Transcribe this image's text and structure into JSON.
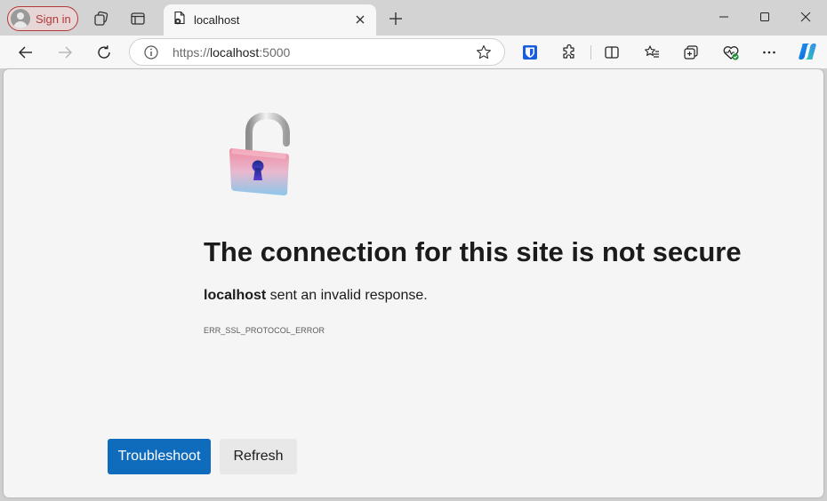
{
  "browser": {
    "signin_label": "Sign in",
    "tab": {
      "title": "localhost"
    },
    "address": {
      "scheme": "https://",
      "host": "localhost",
      "port": ":5000"
    }
  },
  "error_page": {
    "title": "The connection for this site is not secure",
    "description_host": "localhost",
    "description_rest": " sent an invalid response.",
    "error_code": "ERR_SSL_PROTOCOL_ERROR",
    "troubleshoot_label": "Troubleshoot",
    "refresh_label": "Refresh"
  },
  "colors": {
    "accent": "#0f6cbd",
    "signin_border": "#b33a3a",
    "page_bg": "#f5f5f5",
    "chrome_bg": "#d3d3d3"
  }
}
